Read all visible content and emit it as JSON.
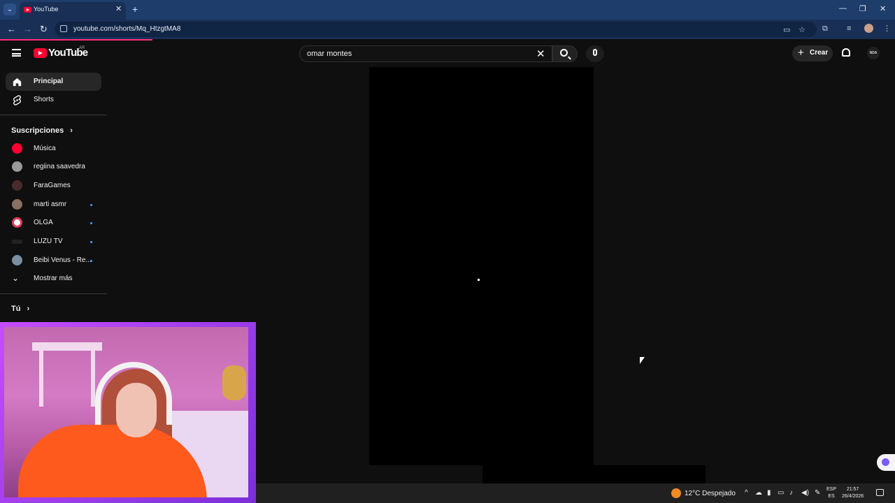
{
  "browser": {
    "tab_title": "YouTube",
    "url": "youtube.com/shorts/Mq_HtzgtMA8",
    "new_tab_symbol": "+",
    "close_symbol": "✕",
    "window_controls": [
      "—",
      "❐",
      "✕"
    ]
  },
  "header": {
    "logo_text": "YouTube",
    "region": "AR",
    "search_query": "omar montes",
    "create_label": "Crear",
    "avatar_text": "NDA"
  },
  "sidebar": {
    "main_items": [
      {
        "label": "Principal",
        "icon": "home-icon",
        "active": true
      },
      {
        "label": "Shorts",
        "icon": "shorts-icon",
        "active": false
      }
    ],
    "subscriptions_title": "Suscripciones",
    "subscriptions": [
      {
        "label": "Música",
        "color": "#ff0033",
        "new": false
      },
      {
        "label": "regiina saavedra",
        "color": "#9a9a9a",
        "new": false
      },
      {
        "label": "FaraGames",
        "color": "#4a2a2a",
        "new": false
      },
      {
        "label": "marti asmr",
        "color": "#8a7060",
        "new": true
      },
      {
        "label": "OLGA",
        "color": "#ffffff",
        "new": true
      },
      {
        "label": "LUZU TV",
        "color": "#222222",
        "new": true
      },
      {
        "label": "Beibi Venus - Re...",
        "color": "#7a8fa0",
        "new": true
      }
    ],
    "show_more": "Mostrar más",
    "you_title": "Tú"
  },
  "taskbar": {
    "weather": "12°C  Despejado",
    "lang_top": "ESP",
    "lang_bottom": "ES",
    "time": "21:57",
    "date": "26/4/2026"
  },
  "colors": {
    "background": "#0f0f0f",
    "accent": "#ff0033",
    "tabbar": "#1e3d6b"
  }
}
